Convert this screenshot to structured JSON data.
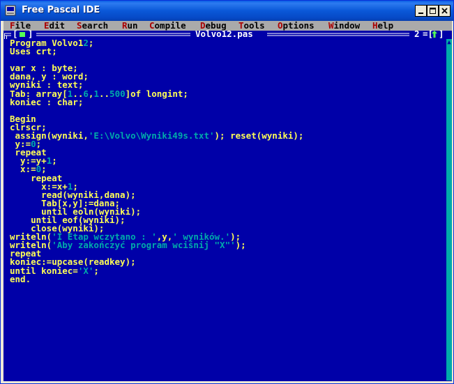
{
  "window": {
    "title": "Free Pascal IDE"
  },
  "menu": {
    "items": [
      {
        "hotkey": "F",
        "rest": "ile"
      },
      {
        "hotkey": "E",
        "rest": "dit"
      },
      {
        "hotkey": "S",
        "rest": "earch"
      },
      {
        "hotkey": "R",
        "rest": "un"
      },
      {
        "hotkey": "C",
        "rest": "ompile"
      },
      {
        "hotkey": "D",
        "rest": "ebug"
      },
      {
        "hotkey": "T",
        "rest": "ools"
      },
      {
        "hotkey": "O",
        "rest": "ptions"
      },
      {
        "hotkey": "W",
        "rest": "indow"
      },
      {
        "hotkey": "H",
        "rest": "elp"
      }
    ]
  },
  "editor": {
    "filename": "Volvo12.pas",
    "window_number": "2",
    "lines": [
      "Program Volvo12;",
      "Uses crt;",
      "",
      "var x : byte;",
      "dana, y : word;",
      "wyniki : text;",
      "Tab: array[1..6,1..500]of longint;",
      "koniec : char;",
      "",
      "Begin",
      "clrscr;",
      " assign(wyniki,'E:\\Volvo\\Wyniki49s.txt'); reset(wyniki);",
      " y:=0;",
      " repeat",
      "  y:=y+1;",
      "  x:=0;",
      "    repeat",
      "      x:=x+1;",
      "      read(wyniki,dana);",
      "      Tab[x,y]:=dana;",
      "      until eoln(wyniki);",
      "    until eof(wyniki);",
      "    close(wyniki);",
      "writeln('I Etap wczytano : ',y,' wyników.');",
      "writeln('Aby zakończyć program wciśnij \"X\"');",
      "repeat",
      "koniec:=upcase(readkey);",
      "until koniec='X';",
      "end."
    ]
  },
  "colors": {
    "editor_bg": "#0000A8",
    "keyword_text": "#FFFF55",
    "string_text": "#00AAAA",
    "number_text": "#00AAAA",
    "frame_text": "#FFFFFF",
    "menu_bg": "#AAAAAA",
    "menu_hotkey": "#AA0000"
  },
  "icons": {
    "app": "pascal-app-icon",
    "close_box": "green-square-icon",
    "zoom": "up-arrow-icon",
    "scroll_up": "scroll-up-arrow-icon"
  }
}
